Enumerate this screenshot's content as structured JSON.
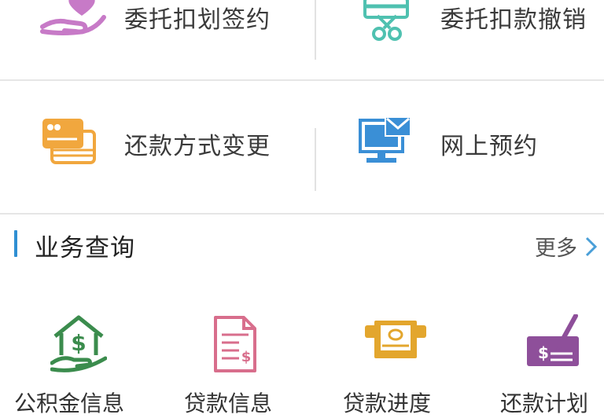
{
  "services": [
    {
      "label": "委托扣划签约",
      "icon": "hand-heart-icon"
    },
    {
      "label": "委托扣款撤销",
      "icon": "scissors-card-icon"
    },
    {
      "label": "还款方式变更",
      "icon": "credit-card-icon"
    },
    {
      "label": "网上预约",
      "icon": "computer-mail-icon"
    }
  ],
  "section": {
    "title": "业务查询",
    "more": "更多"
  },
  "queries": [
    {
      "label": "公积金信息",
      "icon": "house-dollar-hand-icon"
    },
    {
      "label": "贷款信息",
      "icon": "dollar-document-icon"
    },
    {
      "label": "贷款进度",
      "icon": "cash-slot-icon"
    },
    {
      "label": "还款计划",
      "icon": "check-pen-icon"
    }
  ],
  "colors": {
    "accent": "#2f8fd3",
    "purple": "#c77ac7",
    "teal": "#4fc1b0",
    "orange": "#f1a73e",
    "blue": "#3a8fd6",
    "green": "#3b8c4d",
    "pink": "#d86e8c",
    "gold": "#e3a62d",
    "violet": "#8e4f9a"
  }
}
